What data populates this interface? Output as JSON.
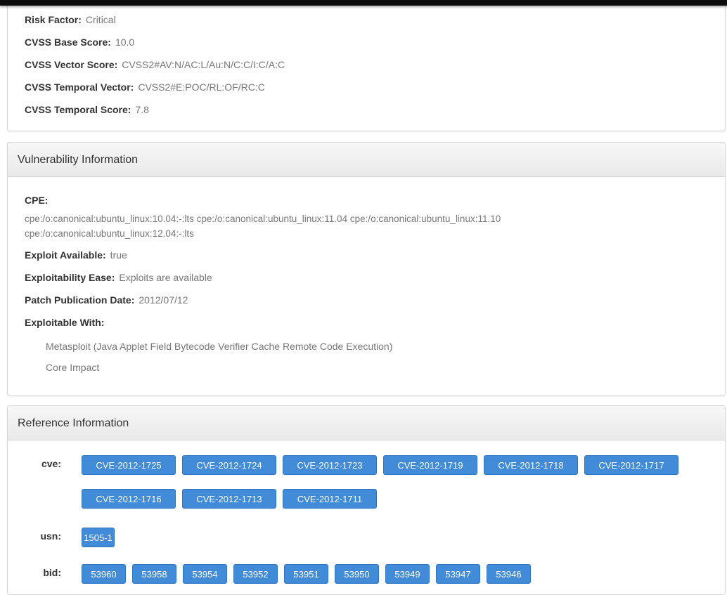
{
  "risk": {
    "risk_factor_label": "Risk Factor:",
    "risk_factor_value": "Critical",
    "cvss_base_label": "CVSS Base Score:",
    "cvss_base_value": "10.0",
    "cvss_vector_label": "CVSS Vector Score:",
    "cvss_vector_value": "CVSS2#AV:N/AC:L/Au:N/C:C/I:C/A:C",
    "temporal_vector_label": "CVSS Temporal Vector:",
    "temporal_vector_value": "CVSS2#E:POC/RL:OF/RC:C",
    "temporal_score_label": "CVSS Temporal Score:",
    "temporal_score_value": "7.8"
  },
  "vuln": {
    "title": "Vulnerability Information",
    "cpe_label": "CPE:",
    "cpe_line1": "cpe:/o:canonical:ubuntu_linux:10.04:-:lts cpe:/o:canonical:ubuntu_linux:11.04 cpe:/o:canonical:ubuntu_linux:11.10",
    "cpe_line2": "cpe:/o:canonical:ubuntu_linux:12.04:-:lts",
    "exploit_available_label": "Exploit Available:",
    "exploit_available_value": "true",
    "exploitability_ease_label": "Exploitability Ease:",
    "exploitability_ease_value": "Exploits are available",
    "patch_date_label": "Patch Publication Date:",
    "patch_date_value": "2012/07/12",
    "exploitable_with_label": "Exploitable With:",
    "exploitable_with": [
      "Metasploit (Java Applet Field Bytecode Verifier Cache Remote Code Execution)",
      "Core Impact"
    ]
  },
  "ref": {
    "title": "Reference Information",
    "cve_label": "cve:",
    "cve": [
      "CVE-2012-1725",
      "CVE-2012-1724",
      "CVE-2012-1723",
      "CVE-2012-1719",
      "CVE-2012-1718",
      "CVE-2012-1717",
      "CVE-2012-1716",
      "CVE-2012-1713",
      "CVE-2012-1711"
    ],
    "usn_label": "usn:",
    "usn": [
      "1505-1"
    ],
    "bid_label": "bid:",
    "bid": [
      "53960",
      "53958",
      "53954",
      "53952",
      "53951",
      "53950",
      "53949",
      "53947",
      "53946"
    ]
  },
  "colors": {
    "tag_background": "#428bd9",
    "tag_text": "#ffffff",
    "panel_header": "#eeeeee"
  }
}
